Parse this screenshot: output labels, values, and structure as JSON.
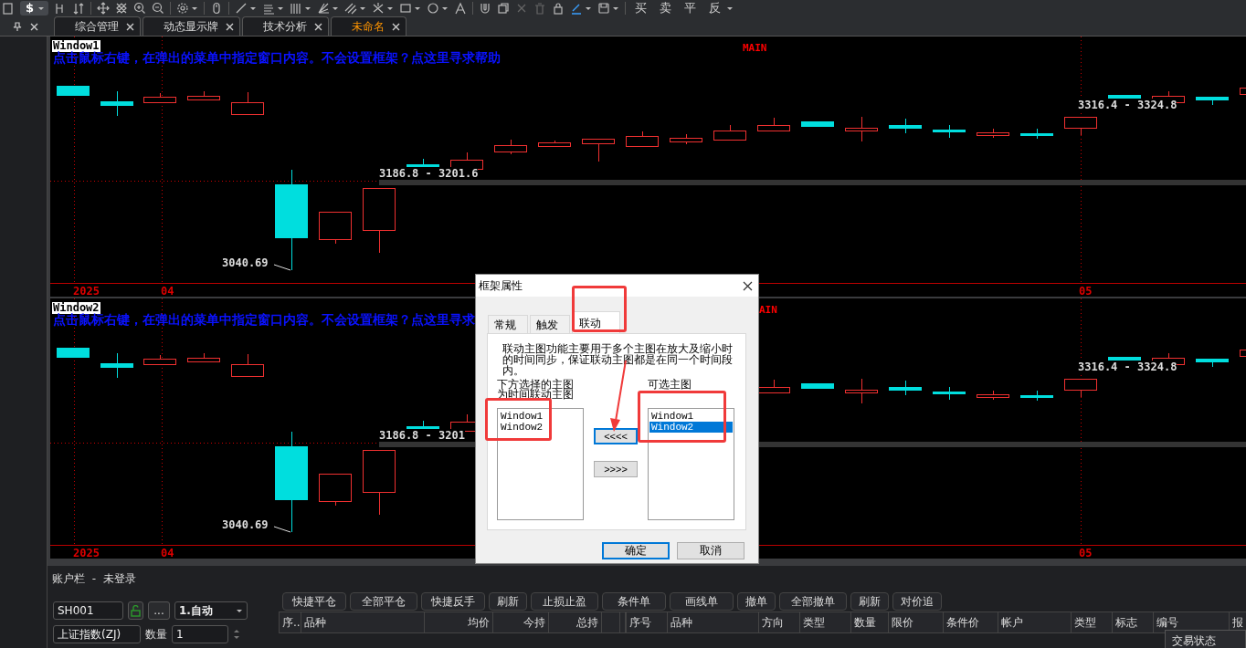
{
  "toolbar": {
    "currency_symbol": "$",
    "text_buttons": [
      "买",
      "卖",
      "平",
      "反"
    ]
  },
  "tabs": [
    {
      "label": "综合管理",
      "selected": false
    },
    {
      "label": "动态显示牌",
      "selected": false
    },
    {
      "label": "技术分析",
      "selected": false
    },
    {
      "label": "未命名",
      "selected": true
    }
  ],
  "panels": [
    {
      "title": "Window1",
      "hint": "点击鼠标右键，在弹出的菜单中指定窗口内容。不会设置框架？点这里寻求帮助",
      "main_label": "MAIN",
      "range_labels": [
        "3186.8 - 3201.6",
        "3316.4 - 3324.8"
      ],
      "low_label": "3040.69",
      "axis_labels": [
        "2025",
        "04",
        "05"
      ]
    },
    {
      "title": "Window2",
      "hint": "点击鼠标右键，在弹出的菜单中指定窗口内容。不会设置框架？点这里寻求",
      "main_label": "AIN",
      "range_labels": [
        "3186.8 - 3201",
        "3316.4 - 3324.8"
      ],
      "low_label": "3040.69",
      "axis_labels": [
        "2025",
        "04",
        "05"
      ]
    }
  ],
  "dialog": {
    "title": "框架属性",
    "tabs": [
      {
        "label": "常规",
        "selected": false
      },
      {
        "label": "触发",
        "selected": false
      },
      {
        "label": "联动",
        "selected": true
      }
    ],
    "description": "联动主图功能主要用于多个主图在放大及缩小时的时间同步，保证联动主图都是在同一个时间段内。",
    "linked_label": "下方选择的主图为时间联动主图",
    "linked_items": [
      {
        "label": "Window1",
        "selected": false
      },
      {
        "label": "Window2",
        "selected": false
      }
    ],
    "available_label": "可选主图",
    "available_items": [
      {
        "label": "Window1",
        "selected": false
      },
      {
        "label": "Window2",
        "selected": true
      }
    ],
    "transfer_buttons": [
      {
        "label": "<<<<",
        "focused": true
      },
      {
        "label": ">>>>",
        "focused": false
      }
    ],
    "footer_buttons": [
      {
        "label": "确定",
        "focused": true
      },
      {
        "label": "取消",
        "focused": false
      }
    ]
  },
  "account": {
    "title": "账户栏  -  未登录",
    "account_field": "SH001",
    "more_button": "...",
    "mode_select": "1.自动",
    "symbol_field": "上证指数(ZJ)",
    "quantity_label": "数量",
    "quantity_field": "1",
    "actions": [
      "快捷平仓",
      "全部平仓",
      "快捷反手",
      "刷新",
      "止损止盈",
      "条件单",
      "画线单",
      "撤单",
      "全部撤单",
      "刷新",
      "对价追"
    ],
    "positions_columns": [
      "序..",
      "品种",
      "均价",
      "今持",
      "总持"
    ],
    "orders_columns": [
      "序号",
      "品种",
      "方向",
      "类型",
      "数量",
      "限价",
      "条件价",
      "帐户",
      "类型",
      "标志",
      "编号",
      "报"
    ]
  },
  "status_popup": "交易状态"
}
